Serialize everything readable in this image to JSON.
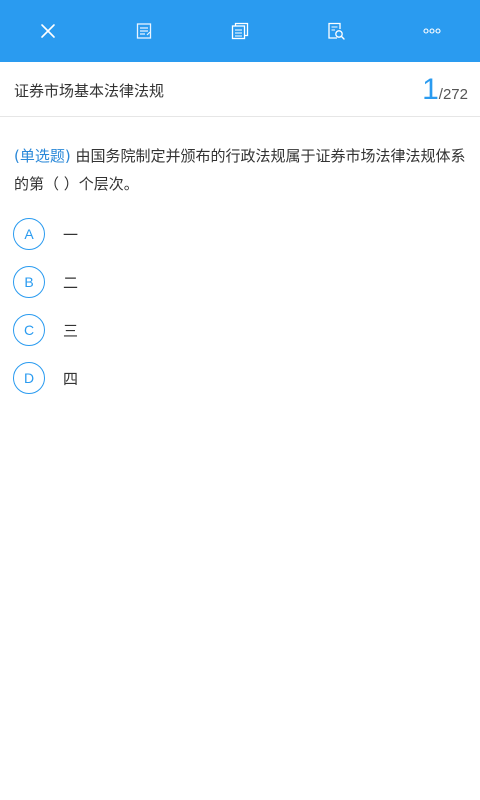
{
  "toolbar": {
    "background": "#2a9bf0",
    "icons": [
      "close-icon",
      "note-icon",
      "copy-icon",
      "search-doc-icon",
      "more-icon"
    ]
  },
  "header": {
    "subject": "证券市场基本法律法规",
    "current_index": "1",
    "total": "/272"
  },
  "question": {
    "type_label": "(单选题)",
    "text": " 由国务院制定并颁布的行政法规属于证券市场法律法规体系的第（ ）个层次。"
  },
  "options": [
    {
      "letter": "A",
      "text": "一"
    },
    {
      "letter": "B",
      "text": "二"
    },
    {
      "letter": "C",
      "text": "三"
    },
    {
      "letter": "D",
      "text": "四"
    }
  ]
}
